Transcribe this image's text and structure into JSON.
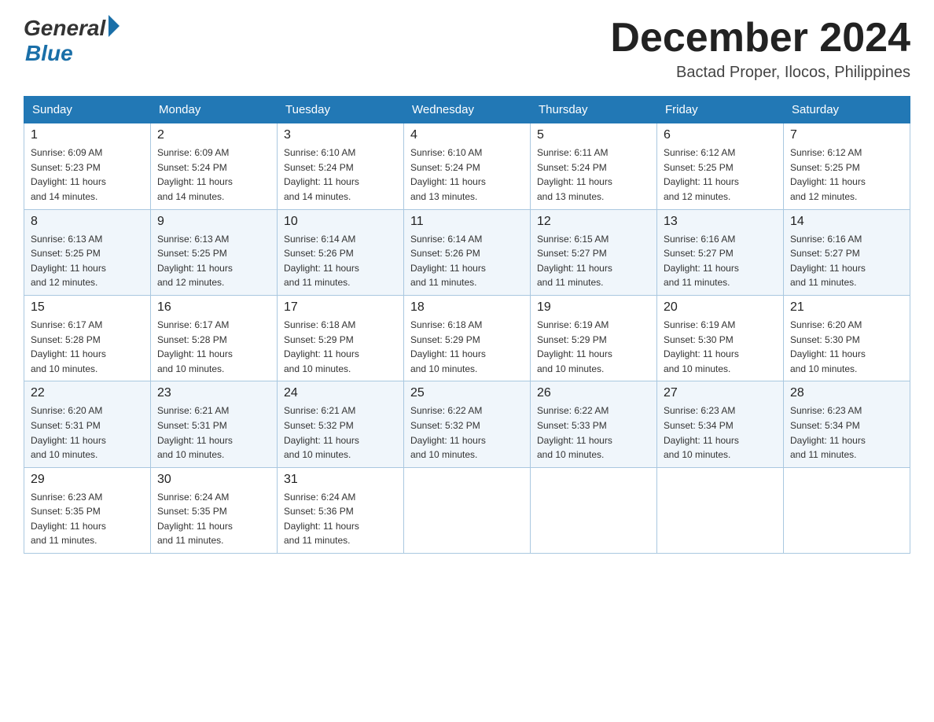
{
  "header": {
    "logo_general": "General",
    "logo_blue": "Blue",
    "month_title": "December 2024",
    "location": "Bactad Proper, Ilocos, Philippines"
  },
  "weekdays": [
    "Sunday",
    "Monday",
    "Tuesday",
    "Wednesday",
    "Thursday",
    "Friday",
    "Saturday"
  ],
  "weeks": [
    [
      {
        "day": "1",
        "sunrise": "6:09 AM",
        "sunset": "5:23 PM",
        "daylight": "11 hours and 14 minutes."
      },
      {
        "day": "2",
        "sunrise": "6:09 AM",
        "sunset": "5:24 PM",
        "daylight": "11 hours and 14 minutes."
      },
      {
        "day": "3",
        "sunrise": "6:10 AM",
        "sunset": "5:24 PM",
        "daylight": "11 hours and 14 minutes."
      },
      {
        "day": "4",
        "sunrise": "6:10 AM",
        "sunset": "5:24 PM",
        "daylight": "11 hours and 13 minutes."
      },
      {
        "day": "5",
        "sunrise": "6:11 AM",
        "sunset": "5:24 PM",
        "daylight": "11 hours and 13 minutes."
      },
      {
        "day": "6",
        "sunrise": "6:12 AM",
        "sunset": "5:25 PM",
        "daylight": "11 hours and 12 minutes."
      },
      {
        "day": "7",
        "sunrise": "6:12 AM",
        "sunset": "5:25 PM",
        "daylight": "11 hours and 12 minutes."
      }
    ],
    [
      {
        "day": "8",
        "sunrise": "6:13 AM",
        "sunset": "5:25 PM",
        "daylight": "11 hours and 12 minutes."
      },
      {
        "day": "9",
        "sunrise": "6:13 AM",
        "sunset": "5:25 PM",
        "daylight": "11 hours and 12 minutes."
      },
      {
        "day": "10",
        "sunrise": "6:14 AM",
        "sunset": "5:26 PM",
        "daylight": "11 hours and 11 minutes."
      },
      {
        "day": "11",
        "sunrise": "6:14 AM",
        "sunset": "5:26 PM",
        "daylight": "11 hours and 11 minutes."
      },
      {
        "day": "12",
        "sunrise": "6:15 AM",
        "sunset": "5:27 PM",
        "daylight": "11 hours and 11 minutes."
      },
      {
        "day": "13",
        "sunrise": "6:16 AM",
        "sunset": "5:27 PM",
        "daylight": "11 hours and 11 minutes."
      },
      {
        "day": "14",
        "sunrise": "6:16 AM",
        "sunset": "5:27 PM",
        "daylight": "11 hours and 11 minutes."
      }
    ],
    [
      {
        "day": "15",
        "sunrise": "6:17 AM",
        "sunset": "5:28 PM",
        "daylight": "11 hours and 10 minutes."
      },
      {
        "day": "16",
        "sunrise": "6:17 AM",
        "sunset": "5:28 PM",
        "daylight": "11 hours and 10 minutes."
      },
      {
        "day": "17",
        "sunrise": "6:18 AM",
        "sunset": "5:29 PM",
        "daylight": "11 hours and 10 minutes."
      },
      {
        "day": "18",
        "sunrise": "6:18 AM",
        "sunset": "5:29 PM",
        "daylight": "11 hours and 10 minutes."
      },
      {
        "day": "19",
        "sunrise": "6:19 AM",
        "sunset": "5:29 PM",
        "daylight": "11 hours and 10 minutes."
      },
      {
        "day": "20",
        "sunrise": "6:19 AM",
        "sunset": "5:30 PM",
        "daylight": "11 hours and 10 minutes."
      },
      {
        "day": "21",
        "sunrise": "6:20 AM",
        "sunset": "5:30 PM",
        "daylight": "11 hours and 10 minutes."
      }
    ],
    [
      {
        "day": "22",
        "sunrise": "6:20 AM",
        "sunset": "5:31 PM",
        "daylight": "11 hours and 10 minutes."
      },
      {
        "day": "23",
        "sunrise": "6:21 AM",
        "sunset": "5:31 PM",
        "daylight": "11 hours and 10 minutes."
      },
      {
        "day": "24",
        "sunrise": "6:21 AM",
        "sunset": "5:32 PM",
        "daylight": "11 hours and 10 minutes."
      },
      {
        "day": "25",
        "sunrise": "6:22 AM",
        "sunset": "5:32 PM",
        "daylight": "11 hours and 10 minutes."
      },
      {
        "day": "26",
        "sunrise": "6:22 AM",
        "sunset": "5:33 PM",
        "daylight": "11 hours and 10 minutes."
      },
      {
        "day": "27",
        "sunrise": "6:23 AM",
        "sunset": "5:34 PM",
        "daylight": "11 hours and 10 minutes."
      },
      {
        "day": "28",
        "sunrise": "6:23 AM",
        "sunset": "5:34 PM",
        "daylight": "11 hours and 11 minutes."
      }
    ],
    [
      {
        "day": "29",
        "sunrise": "6:23 AM",
        "sunset": "5:35 PM",
        "daylight": "11 hours and 11 minutes."
      },
      {
        "day": "30",
        "sunrise": "6:24 AM",
        "sunset": "5:35 PM",
        "daylight": "11 hours and 11 minutes."
      },
      {
        "day": "31",
        "sunrise": "6:24 AM",
        "sunset": "5:36 PM",
        "daylight": "11 hours and 11 minutes."
      },
      null,
      null,
      null,
      null
    ]
  ],
  "labels": {
    "sunrise": "Sunrise:",
    "sunset": "Sunset:",
    "daylight": "Daylight:"
  }
}
